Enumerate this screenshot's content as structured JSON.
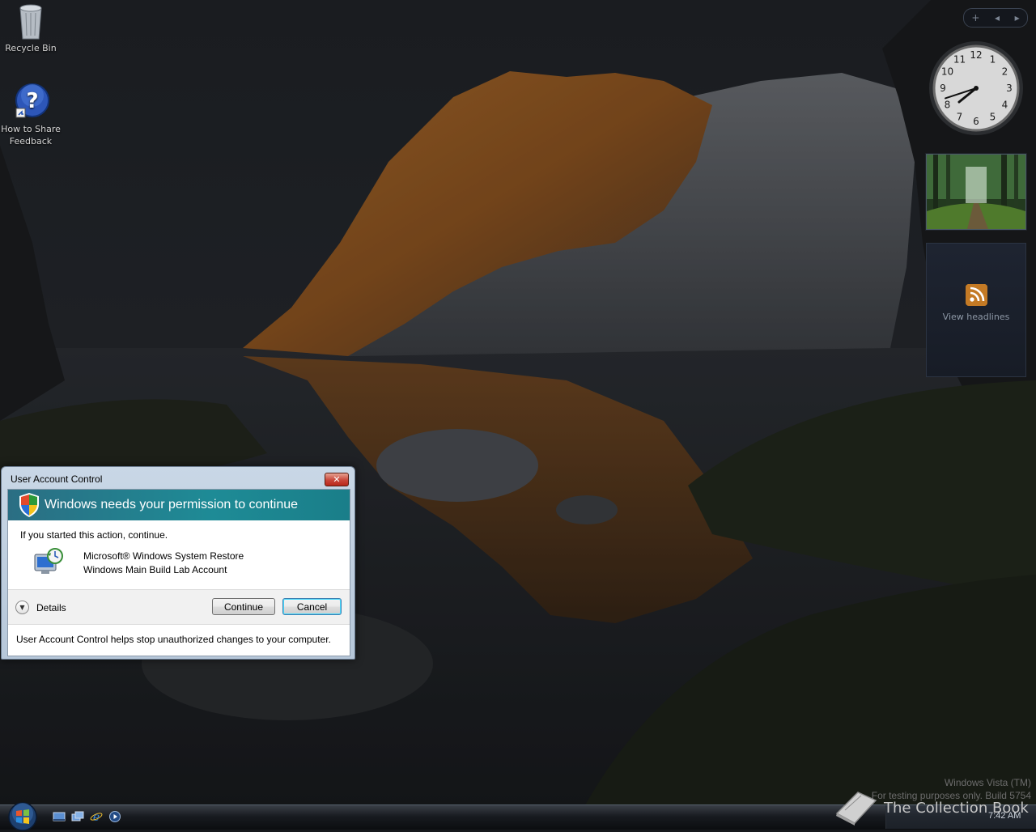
{
  "desktop": {
    "icons": [
      {
        "label": "Recycle Bin",
        "icon": "recycle-bin-icon"
      },
      {
        "label": "How to Share Feedback",
        "icon": "help-icon"
      }
    ]
  },
  "sidebar": {
    "controls": {
      "add": "+",
      "prev": "◂",
      "next": "▸"
    },
    "clock": {
      "hour": 7,
      "minute": 42
    },
    "feed": {
      "label": "View headlines",
      "icon": "rss-icon"
    }
  },
  "dialog": {
    "title": "User Account Control",
    "close_label": "✕",
    "heading": "Windows needs your permission to continue",
    "prompt": "If you started this action, continue.",
    "program": "Microsoft® Windows System Restore",
    "publisher": "Windows Main Build Lab Account",
    "details_label": "Details",
    "continue_label": "Continue",
    "cancel_label": "Cancel",
    "footer": "User Account Control helps stop unauthorized changes to your computer.",
    "banner_color": "#1e8b96"
  },
  "taskbar": {
    "time": "7:42 AM",
    "quick_launch": [
      "show-desktop-icon",
      "switch-windows-icon",
      "internet-explorer-icon",
      "media-player-icon"
    ]
  },
  "watermark": {
    "os": "Windows Vista (TM)",
    "build": "For testing purposes only. Build 5754",
    "brand": "The Collection Book"
  }
}
